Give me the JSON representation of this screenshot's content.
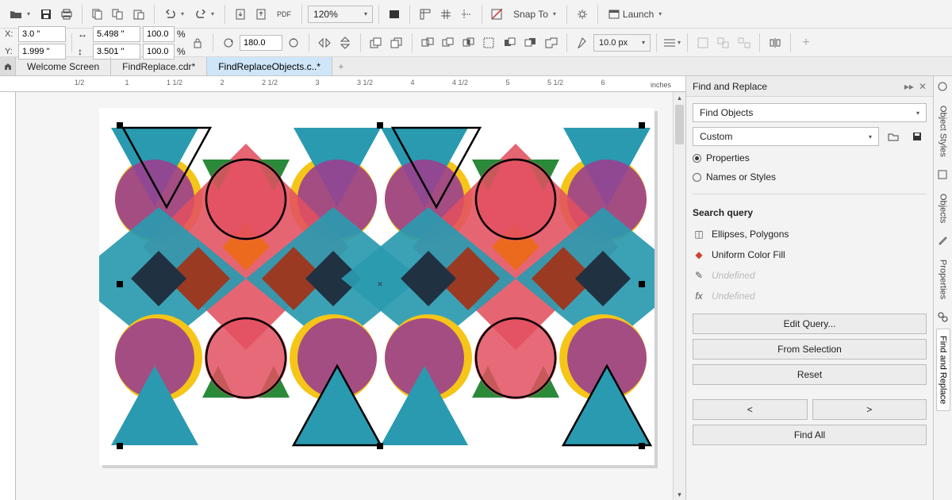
{
  "top_toolbar": {
    "zoom": "120%",
    "snap_to": "Snap To",
    "launch": "Launch",
    "pdf": "PDF"
  },
  "property_bar": {
    "x_label": "X:",
    "x_value": "3.0 \"",
    "y_label": "Y:",
    "y_value": "1.999 \"",
    "w_value": "5.498 \"",
    "h_value": "3.501 \"",
    "sx_value": "100.0",
    "sy_value": "100.0",
    "pct": "%",
    "rotation": "180.0",
    "outline_width": "10.0 px"
  },
  "tabs": {
    "t0": "Welcome Screen",
    "t1": "FindReplace.cdr*",
    "t2": "FindReplaceObjects.c..*"
  },
  "ruler": {
    "units": "inches",
    "marks": [
      "1/2",
      "1",
      "1 1/2",
      "2",
      "2 1/2",
      "3",
      "3 1/2",
      "4",
      "4 1/2",
      "5",
      "5 1/2",
      "6"
    ]
  },
  "panel": {
    "title": "Find and Replace",
    "mode": "Find Objects",
    "preset": "Custom",
    "opt_properties": "Properties",
    "opt_names": "Names or Styles",
    "search_query": "Search query",
    "q_types": "Ellipses, Polygons",
    "q_fill": "Uniform Color Fill",
    "q_outline": "Undefined",
    "q_fx": "Undefined",
    "btn_edit": "Edit Query...",
    "btn_fromsel": "From Selection",
    "btn_reset": "Reset",
    "btn_prev": "<",
    "btn_next": ">",
    "btn_findall": "Find All"
  },
  "vstrip": {
    "t0": "Object Styles",
    "t1": "Objects",
    "t2": "Properties",
    "t3": "Find and Replace"
  },
  "icons": {
    "folder_open": "open",
    "save": "save",
    "print": "print",
    "copy": "copy",
    "paste": "paste",
    "undo": "undo",
    "redo": "redo",
    "import": "import",
    "export": "export",
    "fullscreen": "fullscreen",
    "grid": "grid",
    "guides": "guides",
    "snap": "snap",
    "options": "options",
    "launch": "launch"
  }
}
